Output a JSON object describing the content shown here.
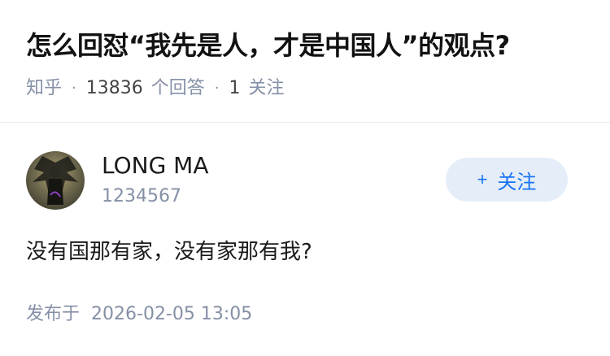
{
  "question": {
    "title": "怎么回怼“我先是人，才是中国人”的观点?",
    "source": "知乎",
    "answer_count": "13836",
    "answer_label": "个回答",
    "follow_count": "1",
    "follow_label": "关注"
  },
  "author": {
    "name": "LONG MA",
    "id_text": "1234567",
    "follow_button": {
      "plus": "+",
      "label": "关注"
    }
  },
  "answer": {
    "text": "没有国那有家，没有家那有我?"
  },
  "footer": {
    "published_label": "发布于",
    "published_time": "2026-02-05 13:05"
  },
  "colors": {
    "accent": "#1772f6",
    "button_bg": "#e5eef8",
    "meta": "#8590a6",
    "text": "#121212"
  },
  "icons": {
    "avatar": "avatar-dark-winged-figure"
  }
}
